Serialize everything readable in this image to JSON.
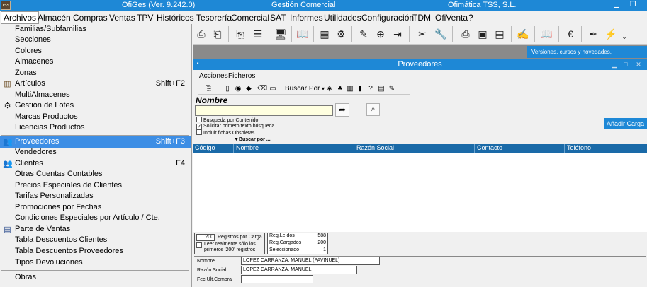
{
  "titlebar": {
    "title": "OfiGes (Ver. 9.242.0)",
    "center": "Gestión Comercial",
    "company": "Ofimática TSS, S.L.",
    "logo": "tss-logo"
  },
  "menubar": [
    "Archivos",
    "Almacén",
    "Compras",
    "Ventas",
    "TPV",
    "Históricos",
    "Tesorería",
    "Comercial",
    "SAT",
    "Informes",
    "Utilidades",
    "Configuración",
    "TDM",
    "OfiVenta",
    "?"
  ],
  "archivos_menu": {
    "group1": [
      {
        "label": "Familias/Subfamilias",
        "icon": ""
      },
      {
        "label": "Secciones",
        "icon": ""
      },
      {
        "label": "Colores",
        "icon": ""
      },
      {
        "label": "Almacenes",
        "icon": ""
      },
      {
        "label": "Zonas",
        "icon": ""
      },
      {
        "label": "Artículos",
        "icon": "books-icon",
        "shortcut": "Shift+F2"
      },
      {
        "label": "MultiAlmacenes",
        "icon": ""
      },
      {
        "label": "Gestión de Lotes",
        "icon": "gear-icon"
      },
      {
        "label": "Marcas Productos",
        "icon": ""
      },
      {
        "label": "Licencias Productos",
        "icon": ""
      }
    ],
    "group2": [
      {
        "label": "Proveedores",
        "icon": "people-icon",
        "shortcut": "Shift+F3",
        "selected": true
      },
      {
        "label": "Vendedores",
        "icon": ""
      },
      {
        "label": "Clientes",
        "icon": "people-icon",
        "shortcut": "F4"
      },
      {
        "label": "Otras Cuentas Contables",
        "icon": ""
      },
      {
        "label": "Precios Especiales de Clientes",
        "icon": ""
      },
      {
        "label": "Tarifas Personalizadas",
        "icon": ""
      },
      {
        "label": "Promociones por Fechas",
        "icon": ""
      },
      {
        "label": "Condiciones Especiales por Artículo / Cte.",
        "icon": ""
      },
      {
        "label": "Parte de Ventas",
        "icon": "document-icon"
      },
      {
        "label": "Tabla Descuentos Clientes",
        "icon": ""
      },
      {
        "label": "Tabla Descuentos Proveedores",
        "icon": ""
      },
      {
        "label": "Tipos Devoluciones",
        "icon": ""
      }
    ],
    "group3": [
      {
        "label": "Obras",
        "icon": ""
      }
    ]
  },
  "news_banner": "Versiones, cursos y novedades.",
  "proveedores_window": {
    "title": "Proveedores",
    "menu": [
      "Acciones",
      "Ficheros"
    ],
    "buscar_por_button": "Buscar Por",
    "nombre_label": "Nombre",
    "search_value": "",
    "checkboxes": [
      {
        "label": "Busqueda por Contenido",
        "checked": false
      },
      {
        "label": "Solicitar primero texto búsqueda",
        "checked": true
      },
      {
        "label": "Incluir fichas Obsoletas",
        "checked": false
      }
    ],
    "buscar_por_label": "Buscar por ...",
    "anadir_carga": "Añadir Carga",
    "columns": [
      "Código",
      "Nombre",
      "Razón Social",
      "Contacto",
      "Teléfono"
    ],
    "rows": [],
    "registros": {
      "value": "200",
      "label": "Registros por Carga"
    },
    "leer_label": "Leer realmente sólo los primeros '200' registros",
    "stats": [
      {
        "label": "Reg.Leídos",
        "value": "588"
      },
      {
        "label": "Reg.Cargados",
        "value": "200"
      },
      {
        "label": "Seleccionado",
        "value": "1"
      }
    ],
    "detail": [
      {
        "label": "Nombre",
        "value": "LOPEZ CARRANZA, MANUEL (PAVINUEL)"
      },
      {
        "label": "Razón Social",
        "value": "LOPEZ CARRANZA, MANUEL"
      },
      {
        "label": "Fec.Ult.Compra",
        "value": ""
      }
    ]
  }
}
